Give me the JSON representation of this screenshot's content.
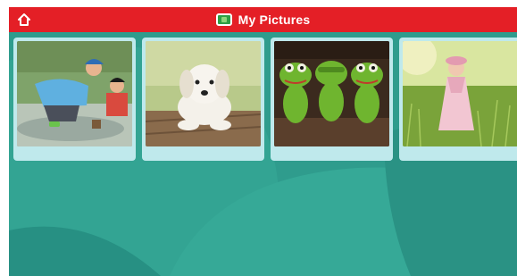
{
  "app": {
    "title": "My Pictures",
    "title_icon": "picture-frame-icon",
    "home_icon": "home-icon"
  },
  "colors": {
    "topbar": "#e41f26",
    "background": "#2f9c8d",
    "card": "#bfe9ec"
  },
  "gallery": {
    "items": [
      {
        "icon": "photo-children-playing"
      },
      {
        "icon": "photo-puppy"
      },
      {
        "icon": "photo-frogs"
      },
      {
        "icon": "photo-girl-in-field"
      }
    ]
  }
}
